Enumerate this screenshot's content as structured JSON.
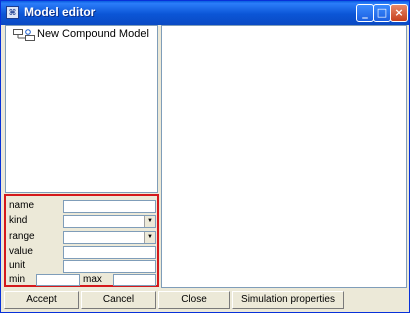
{
  "window": {
    "title": "Model editor",
    "icon": "app-icon"
  },
  "titlebar_buttons": {
    "minimize": "_",
    "maximize": "□",
    "close": "×"
  },
  "tree": {
    "items": [
      {
        "label": "New Compound Model",
        "icon": "compound-model-icon"
      }
    ]
  },
  "properties": {
    "name_label": "name",
    "kind_label": "kind",
    "range_label": "range",
    "value_label": "value",
    "unit_label": "unit",
    "min_label": "min",
    "max_label": "max",
    "dropdown_arrow": "▼"
  },
  "buttons": {
    "accept": "Accept",
    "cancel": "Cancel",
    "close": "Close",
    "simulation_properties": "Simulation properties"
  },
  "colors": {
    "highlight_border": "#d4191c",
    "titlebar": "#0a5ee0"
  }
}
